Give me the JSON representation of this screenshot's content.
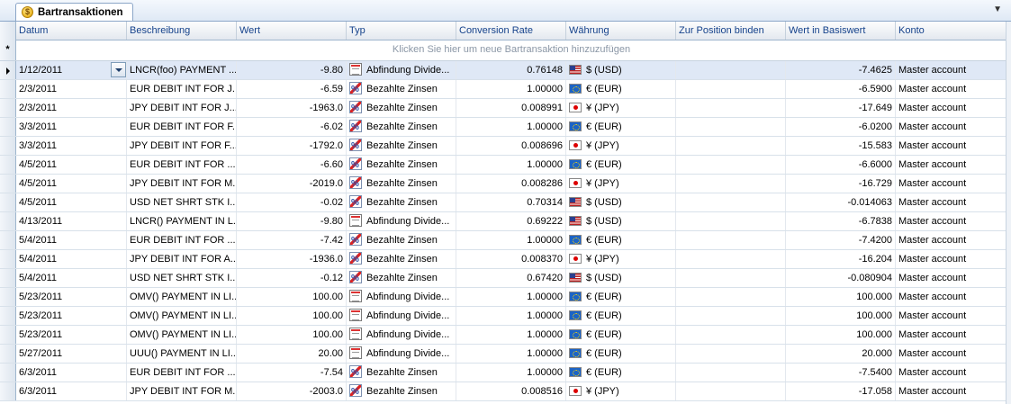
{
  "tab": {
    "title": "Bartransaktionen",
    "icon": "coin-icon",
    "icon_glyph": "$"
  },
  "menu_glyph": "▼",
  "columns": {
    "datum": "Datum",
    "beschreibung": "Beschreibung",
    "wert": "Wert",
    "typ": "Typ",
    "rate": "Conversion Rate",
    "waehrung": "Währung",
    "position": "Zur Position binden",
    "basis": "Wert in Basiswert",
    "konto": "Konto"
  },
  "new_row_prompt": "Klicken Sie hier um neue Bartransaktion hinzuzufügen",
  "new_row_glyph": "*",
  "rows": [
    {
      "datum": "1/12/2011",
      "beschreibung": "LNCR(foo) PAYMENT ...",
      "wert": "-9.80",
      "typ": "Abfindung Divide...",
      "typ_icon": "div",
      "rate": "0.76148",
      "flag": "usd",
      "waehrung": "$ (USD)",
      "basis": "-7.4625",
      "konto": "Master account",
      "selected": true
    },
    {
      "datum": "2/3/2011",
      "beschreibung": "EUR DEBIT INT FOR J...",
      "wert": "-6.59",
      "typ": "Bezahlte Zinsen",
      "typ_icon": "zinsen",
      "rate": "1.00000",
      "flag": "eur",
      "waehrung": "€ (EUR)",
      "basis": "-6.5900",
      "konto": "Master account"
    },
    {
      "datum": "2/3/2011",
      "beschreibung": "JPY DEBIT INT FOR J...",
      "wert": "-1963.0",
      "typ": "Bezahlte Zinsen",
      "typ_icon": "zinsen",
      "rate": "0.008991",
      "flag": "jpy",
      "waehrung": "¥ (JPY)",
      "basis": "-17.649",
      "konto": "Master account"
    },
    {
      "datum": "3/3/2011",
      "beschreibung": "EUR DEBIT INT FOR F...",
      "wert": "-6.02",
      "typ": "Bezahlte Zinsen",
      "typ_icon": "zinsen",
      "rate": "1.00000",
      "flag": "eur",
      "waehrung": "€ (EUR)",
      "basis": "-6.0200",
      "konto": "Master account"
    },
    {
      "datum": "3/3/2011",
      "beschreibung": "JPY DEBIT INT FOR F...",
      "wert": "-1792.0",
      "typ": "Bezahlte Zinsen",
      "typ_icon": "zinsen",
      "rate": "0.008696",
      "flag": "jpy",
      "waehrung": "¥ (JPY)",
      "basis": "-15.583",
      "konto": "Master account"
    },
    {
      "datum": "4/5/2011",
      "beschreibung": "EUR DEBIT INT FOR ...",
      "wert": "-6.60",
      "typ": "Bezahlte Zinsen",
      "typ_icon": "zinsen",
      "rate": "1.00000",
      "flag": "eur",
      "waehrung": "€ (EUR)",
      "basis": "-6.6000",
      "konto": "Master account"
    },
    {
      "datum": "4/5/2011",
      "beschreibung": "JPY DEBIT INT FOR M...",
      "wert": "-2019.0",
      "typ": "Bezahlte Zinsen",
      "typ_icon": "zinsen",
      "rate": "0.008286",
      "flag": "jpy",
      "waehrung": "¥ (JPY)",
      "basis": "-16.729",
      "konto": "Master account"
    },
    {
      "datum": "4/5/2011",
      "beschreibung": "USD NET SHRT STK I...",
      "wert": "-0.02",
      "typ": "Bezahlte Zinsen",
      "typ_icon": "zinsen",
      "rate": "0.70314",
      "flag": "usd",
      "waehrung": "$ (USD)",
      "basis": "-0.014063",
      "konto": "Master account"
    },
    {
      "datum": "4/13/2011",
      "beschreibung": "LNCR() PAYMENT IN L...",
      "wert": "-9.80",
      "typ": "Abfindung Divide...",
      "typ_icon": "div",
      "rate": "0.69222",
      "flag": "usd",
      "waehrung": "$ (USD)",
      "basis": "-6.7838",
      "konto": "Master account"
    },
    {
      "datum": "5/4/2011",
      "beschreibung": "EUR DEBIT INT FOR ...",
      "wert": "-7.42",
      "typ": "Bezahlte Zinsen",
      "typ_icon": "zinsen",
      "rate": "1.00000",
      "flag": "eur",
      "waehrung": "€ (EUR)",
      "basis": "-7.4200",
      "konto": "Master account"
    },
    {
      "datum": "5/4/2011",
      "beschreibung": "JPY DEBIT INT FOR A...",
      "wert": "-1936.0",
      "typ": "Bezahlte Zinsen",
      "typ_icon": "zinsen",
      "rate": "0.008370",
      "flag": "jpy",
      "waehrung": "¥ (JPY)",
      "basis": "-16.204",
      "konto": "Master account"
    },
    {
      "datum": "5/4/2011",
      "beschreibung": "USD NET SHRT STK I...",
      "wert": "-0.12",
      "typ": "Bezahlte Zinsen",
      "typ_icon": "zinsen",
      "rate": "0.67420",
      "flag": "usd",
      "waehrung": "$ (USD)",
      "basis": "-0.080904",
      "konto": "Master account"
    },
    {
      "datum": "5/23/2011",
      "beschreibung": "OMV() PAYMENT IN LI...",
      "wert": "100.00",
      "typ": "Abfindung Divide...",
      "typ_icon": "div",
      "rate": "1.00000",
      "flag": "eur",
      "waehrung": "€ (EUR)",
      "basis": "100.000",
      "konto": "Master account"
    },
    {
      "datum": "5/23/2011",
      "beschreibung": "OMV() PAYMENT IN LI...",
      "wert": "100.00",
      "typ": "Abfindung Divide...",
      "typ_icon": "div",
      "rate": "1.00000",
      "flag": "eur",
      "waehrung": "€ (EUR)",
      "basis": "100.000",
      "konto": "Master account"
    },
    {
      "datum": "5/23/2011",
      "beschreibung": "OMV() PAYMENT IN LI...",
      "wert": "100.00",
      "typ": "Abfindung Divide...",
      "typ_icon": "div",
      "rate": "1.00000",
      "flag": "eur",
      "waehrung": "€ (EUR)",
      "basis": "100.000",
      "konto": "Master account"
    },
    {
      "datum": "5/27/2011",
      "beschreibung": "UUU() PAYMENT IN LI...",
      "wert": "20.00",
      "typ": "Abfindung Divide...",
      "typ_icon": "div",
      "rate": "1.00000",
      "flag": "eur",
      "waehrung": "€ (EUR)",
      "basis": "20.000",
      "konto": "Master account"
    },
    {
      "datum": "6/3/2011",
      "beschreibung": "EUR DEBIT INT FOR ...",
      "wert": "-7.54",
      "typ": "Bezahlte Zinsen",
      "typ_icon": "zinsen",
      "rate": "1.00000",
      "flag": "eur",
      "waehrung": "€ (EUR)",
      "basis": "-7.5400",
      "konto": "Master account"
    },
    {
      "datum": "6/3/2011",
      "beschreibung": "JPY DEBIT INT FOR M...",
      "wert": "-2003.0",
      "typ": "Bezahlte Zinsen",
      "typ_icon": "zinsen",
      "rate": "0.008516",
      "flag": "jpy",
      "waehrung": "¥ (JPY)",
      "basis": "-17.058",
      "konto": "Master account"
    }
  ]
}
